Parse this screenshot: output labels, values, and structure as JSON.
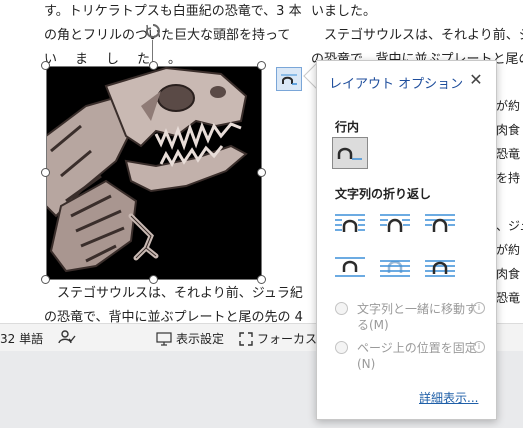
{
  "document": {
    "left_lines": [
      "す。トリケラトプスも白亜紀の恐竜で、3 本",
      "の角とフリルのついた巨大な頭部を持って"
    ],
    "left_spaced_line": "いました。",
    "left_bottom_lines": [
      "　ステゴサウルスは、それより前、ジュラ紀",
      "の恐竜で、背中に並ぶプレートと尾の先の 4"
    ],
    "right_lines": [
      "いました。",
      "　ステゴサウルスは、それより前、ジュラ紀",
      "の恐竜で、背中に並ぶプレートと尾の先の 4"
    ],
    "right_fragments": [
      "が約",
      "肉食",
      "恐竜",
      "を持",
      "",
      "、ジュ",
      "が約",
      "肉食",
      "恐竜"
    ]
  },
  "statusbar": {
    "word_count": "32 単語",
    "display_settings": "表示設定",
    "focus": "フォーカス"
  },
  "layout_popup": {
    "title": "レイアウト オプション",
    "close_label": "✕",
    "inline_section": "行内",
    "wrap_section": "文字列の折り返し",
    "move_with_text": "文字列と一緒に移動する(M)",
    "fix_position": "ページ上の位置を固定(N)",
    "info_glyph": "i",
    "see_more": "詳細表示..."
  },
  "colors": {
    "accent": "#1f4e9c",
    "link": "#1f5fa8",
    "option_blue": "#3c8fd8",
    "icon_dark": "#2b2b2b"
  },
  "icons": {
    "anchor": "layout-options-icon",
    "rotate": "rotate-handle-icon"
  }
}
